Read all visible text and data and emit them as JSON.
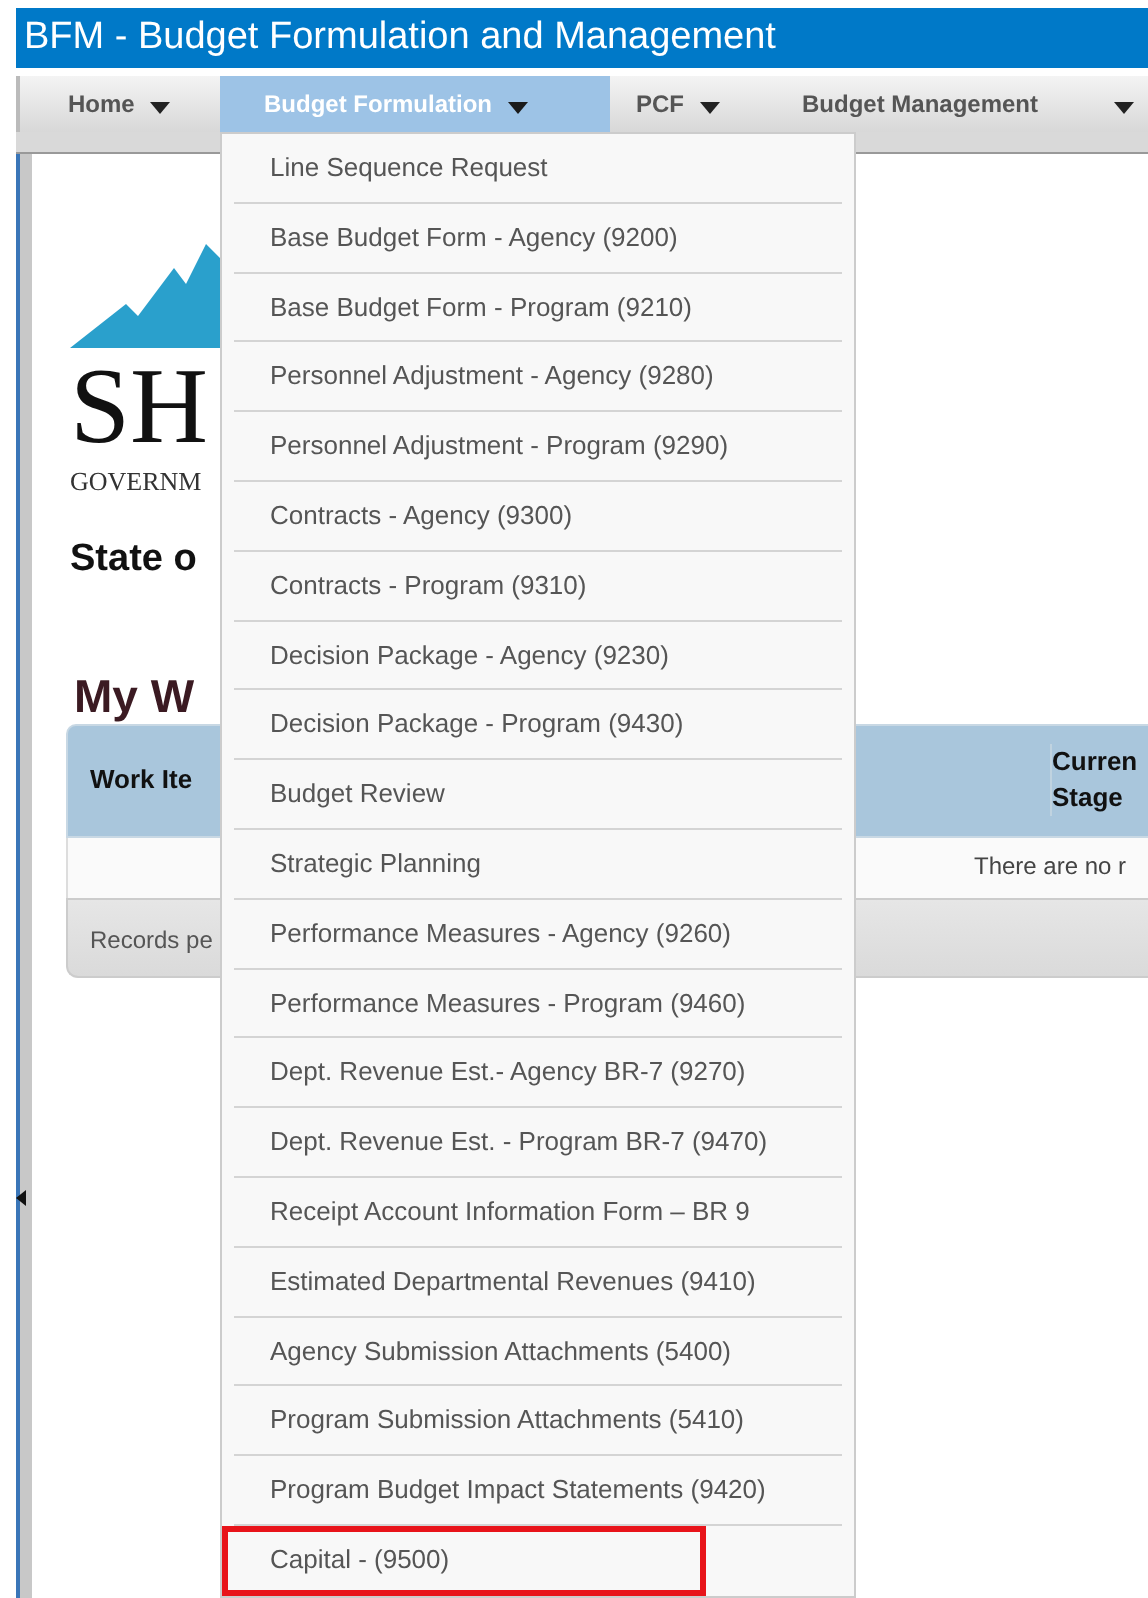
{
  "window": {
    "title": "BFM - Budget Formulation and Management"
  },
  "menubar": [
    {
      "label": "Home",
      "selected": false
    },
    {
      "label": "Budget Formulation",
      "selected": true
    },
    {
      "label": "PCF",
      "selected": false
    },
    {
      "label": "Budget Management",
      "selected": false
    }
  ],
  "logo": {
    "wordmark": "SH",
    "tagline": "GOVERNM"
  },
  "state_heading": "State o",
  "section_heading": "My W",
  "table": {
    "columns": [
      {
        "label": "Work Ite"
      },
      {
        "label": "Curren Stage"
      }
    ],
    "empty_message": "There are no r",
    "footer": "Records pe"
  },
  "dropdown": {
    "items": [
      {
        "label": "Line Sequence Request",
        "highlighted": false
      },
      {
        "label": "Base Budget Form - Agency (9200)",
        "highlighted": false
      },
      {
        "label": "Base Budget Form - Program (9210)",
        "highlighted": false
      },
      {
        "label": "Personnel Adjustment - Agency (9280)",
        "highlighted": false
      },
      {
        "label": "Personnel Adjustment - Program (9290)",
        "highlighted": false
      },
      {
        "label": "Contracts - Agency (9300)",
        "highlighted": false
      },
      {
        "label": "Contracts - Program (9310)",
        "highlighted": false
      },
      {
        "label": "Decision Package - Agency (9230)",
        "highlighted": false
      },
      {
        "label": "Decision Package - Program (9430)",
        "highlighted": false
      },
      {
        "label": "Budget Review",
        "highlighted": false
      },
      {
        "label": "Strategic Planning",
        "highlighted": false
      },
      {
        "label": "Performance Measures - Agency (9260)",
        "highlighted": false
      },
      {
        "label": "Performance Measures - Program (9460)",
        "highlighted": false
      },
      {
        "label": "Dept. Revenue Est.- Agency BR-7 (9270)",
        "highlighted": false
      },
      {
        "label": "Dept. Revenue Est. - Program BR-7 (9470)",
        "highlighted": false
      },
      {
        "label": "Receipt Account Information Form – BR 9",
        "highlighted": false
      },
      {
        "label": "Estimated Departmental Revenues (9410)",
        "highlighted": false
      },
      {
        "label": "Agency Submission Attachments (5400)",
        "highlighted": false
      },
      {
        "label": "Program Submission Attachments (5410)",
        "highlighted": false
      },
      {
        "label": "Program Budget Impact Statements (9420)",
        "highlighted": false
      },
      {
        "label": "Capital - (9500)",
        "highlighted": true
      }
    ]
  }
}
